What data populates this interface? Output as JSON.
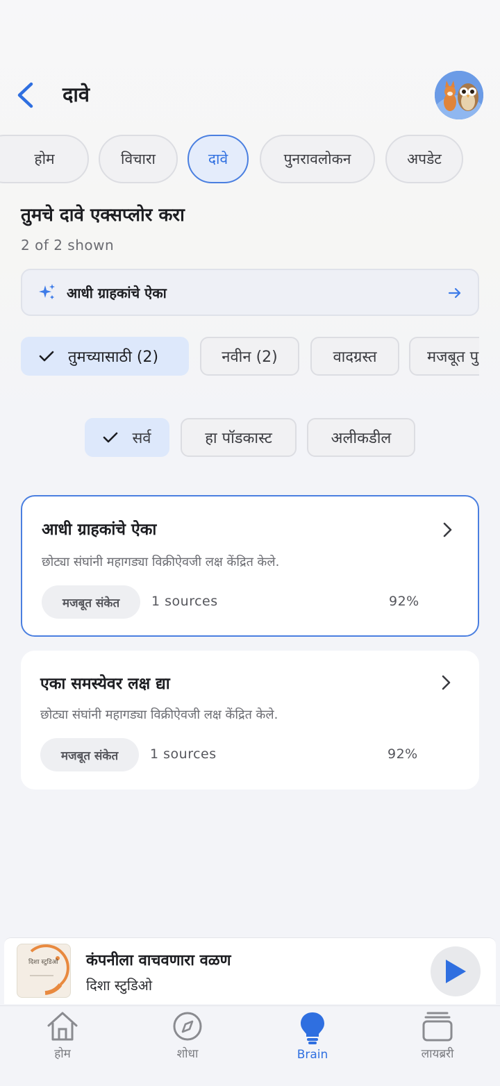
{
  "header": {
    "title": "दावे"
  },
  "tabs": [
    {
      "label": "होम"
    },
    {
      "label": "विचारा"
    },
    {
      "label": "दावे"
    },
    {
      "label": "पुनरावलोकन"
    },
    {
      "label": "अपडेट"
    }
  ],
  "active_tab": "दावे",
  "section": {
    "title": "तुमचे दावे एक्सप्लोर करा",
    "count": "2 of 2 shown"
  },
  "prompt": {
    "label": "आधी ग्राहकांचे ऐका",
    "icon": "sparkle-icon"
  },
  "filters": [
    {
      "label": "तुमच्यासाठी (2)",
      "selected": true
    },
    {
      "label": "नवीन (2)",
      "selected": false
    },
    {
      "label": "वादग्रस्त",
      "selected": false
    },
    {
      "label": "मजबूत पु",
      "selected": false
    }
  ],
  "scope": [
    {
      "label": "सर्व",
      "selected": true
    },
    {
      "label": "हा पॉडकास्ट",
      "selected": false
    },
    {
      "label": "अलीकडील",
      "selected": false
    }
  ],
  "claims": [
    {
      "title": "आधी ग्राहकांचे ऐका",
      "description": "छोट्या संघांनी महागड्या विक्रीऐवजी लक्ष केंद्रित केले.",
      "badge": "मजबूत संकेत",
      "sources": "1 sources",
      "confidence": "92%",
      "selected": true
    },
    {
      "title": "एका समस्येवर लक्ष द्या",
      "description": "छोट्या संघांनी महागड्या विक्रीऐवजी लक्ष केंद्रित केले.",
      "badge": "मजबूत संकेत",
      "sources": "1 sources",
      "confidence": "92%",
      "selected": false
    }
  ],
  "player": {
    "title": "कंपनीला वाचवणारा वळण",
    "subtitle": "दिशा स्टुडिओ",
    "cover_text": "दिशा स्टुडिओ"
  },
  "nav": [
    {
      "label": "होम",
      "icon": "home-icon"
    },
    {
      "label": "शोधा",
      "icon": "compass-icon"
    },
    {
      "label": "Brain",
      "icon": "lightbulb-icon",
      "active": true
    },
    {
      "label": "लायब्ररी",
      "icon": "library-icon"
    }
  ],
  "colors": {
    "accent": "#2f6fe0",
    "chip_selected": "#dde8fb",
    "background": "#f3f4f8"
  }
}
